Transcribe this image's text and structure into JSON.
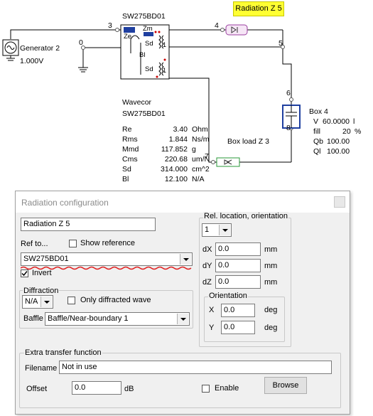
{
  "schematic": {
    "radiation_badge": "Radiation Z 5",
    "driver_title": "SW275BD01",
    "ze_label": "Ze",
    "zm_label": "Zm",
    "bl_label": "Bl",
    "sd_top_label": "Sd",
    "sd_bottom_label": "Sd",
    "ratio_top": "1",
    "ratio_bottom": "1",
    "generator_name": "Generator 2",
    "generator_voltage": "1.000V",
    "nodes": {
      "n0": "0",
      "n3": "3",
      "n4": "4",
      "n5": "5",
      "n6": "6",
      "n7": "7",
      "n8": "8"
    },
    "wavecor_title": "Wavecor",
    "wavecor_model": "SW275BD01",
    "params": [
      {
        "name": "Re",
        "value": "3.40",
        "unit": "Ohm"
      },
      {
        "name": "Rms",
        "value": "1.844",
        "unit": "Ns/m"
      },
      {
        "name": "Mmd",
        "value": "117.852",
        "unit": "g"
      },
      {
        "name": "Cms",
        "value": "220.68",
        "unit": "um/N"
      },
      {
        "name": "Sd",
        "value": "314.000",
        "unit": "cm^2"
      },
      {
        "name": "Bl",
        "value": "12.100",
        "unit": "N/A"
      }
    ],
    "box4": {
      "name": "Box 4",
      "v_label": "V",
      "v_value": "60.0000",
      "v_unit": "l",
      "fill_label": "fill",
      "fill_value": "20",
      "fill_unit": "%",
      "qb_label": "Qb",
      "qb_value": "100.00",
      "ql_label": "Ql",
      "ql_value": "100.00"
    },
    "box_load_label": "Box load Z 3"
  },
  "dialog": {
    "title": "Radiation configuration",
    "name_value": "Radiation Z 5",
    "ref_label": "Ref to...",
    "show_reference_label": "Show reference",
    "ref_value": "SW275BD01",
    "invert_label": "Invert",
    "invert_checked": true,
    "diffraction_group": "Diffraction",
    "diffraction_value": "N/A",
    "only_diffracted_label": "Only diffracted wave",
    "baffle_label": "Baffle",
    "baffle_value": "Baffle/Near-boundary 1",
    "rel_group": "Rel. location, orientation",
    "rel_select": "1",
    "dx_label": "dX",
    "dx_value": "0.0",
    "dx_unit": "mm",
    "dy_label": "dY",
    "dy_value": "0.0",
    "dy_unit": "mm",
    "dz_label": "dZ",
    "dz_value": "0.0",
    "dz_unit": "mm",
    "orientation_group": "Orientation",
    "x_label": "X",
    "x_value": "0.0",
    "x_unit": "deg",
    "y_label": "Y",
    "y_value": "0.0",
    "y_unit": "deg",
    "etf_group": "Extra transfer function",
    "filename_label": "Filename",
    "filename_value": "Not in use",
    "offset_label": "Offset",
    "offset_value": "0.0",
    "offset_unit": "dB",
    "enable_label": "Enable",
    "browse_label": "Browse"
  },
  "colors": {
    "badge": "#ffff33",
    "accent_blue": "#1f3fa0",
    "box_purple": "#9b3fa0",
    "load_green": "#2a9a3a",
    "underline_red": "#e02020"
  }
}
